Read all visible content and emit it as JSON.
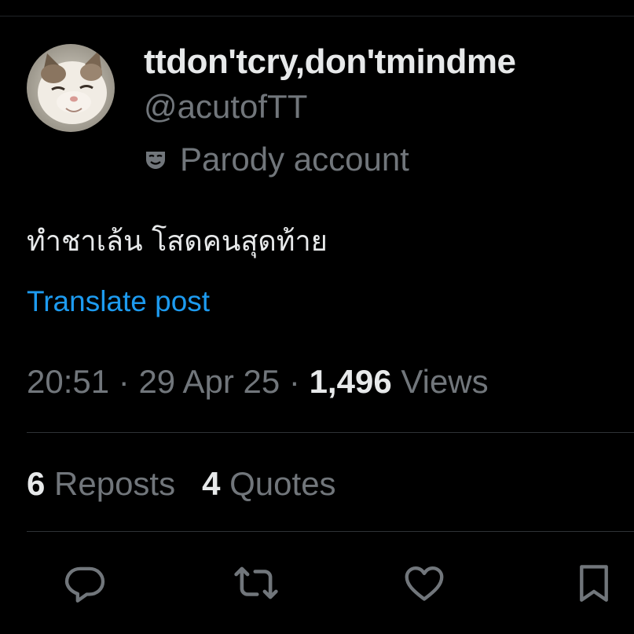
{
  "post": {
    "author": {
      "display_name": "ttdon'tcry,don'tmindme",
      "handle": "@acutofTT",
      "badge_label": "Parody account",
      "badge_icon": "mask-icon",
      "avatar_icon": "cat-avatar"
    },
    "text": "ทำชาเล้น โสดคนสุดท้าย",
    "translate_label": "Translate post",
    "time": "20:51",
    "date": "29 Apr 25",
    "separator": " · ",
    "views_count": "1,496",
    "views_label": " Views"
  },
  "stats": {
    "reposts_count": "6",
    "reposts_label": " Reposts",
    "quotes_count": "4",
    "quotes_label": " Quotes"
  },
  "actions": [
    {
      "icon": "reply-icon"
    },
    {
      "icon": "repost-icon"
    },
    {
      "icon": "like-icon"
    },
    {
      "icon": "bookmark-icon"
    }
  ],
  "colors": {
    "background": "#000000",
    "primary_text": "#e7e9ea",
    "secondary_text": "#71767b",
    "link": "#1d9bf0",
    "divider": "#2f3336"
  }
}
